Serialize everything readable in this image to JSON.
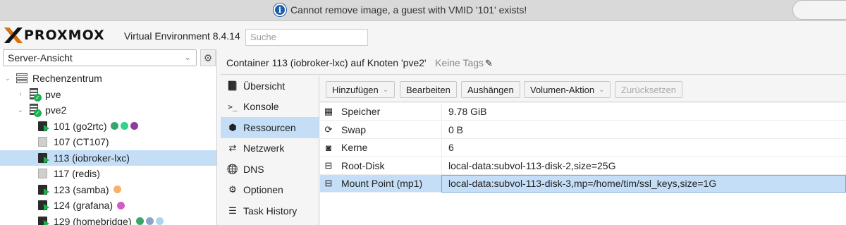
{
  "notification": {
    "message": "Cannot remove image, a guest with VMID '101' exists!",
    "icon": "info-icon"
  },
  "header": {
    "logo_text": "PROXMOX",
    "product": "Virtual Environment 8.4.14",
    "search_placeholder": "Suche"
  },
  "left": {
    "view_select": "Server-Ansicht",
    "tree": [
      {
        "label": "Rechenzentrum",
        "type": "datacenter"
      },
      {
        "label": "pve",
        "type": "node"
      },
      {
        "label": "pve2",
        "type": "node"
      },
      {
        "label": "101 (go2rtc)",
        "type": "ct-running",
        "dots": [
          "#3aa56b",
          "#2fd38e",
          "#8e3c9c"
        ]
      },
      {
        "label": "107 (CT107)",
        "type": "ct-stopped",
        "dots": []
      },
      {
        "label": "113 (iobroker-lxc)",
        "type": "ct-running",
        "dots": [],
        "selected": true
      },
      {
        "label": "117 (redis)",
        "type": "ct-stopped",
        "dots": []
      },
      {
        "label": "123 (samba)",
        "type": "ct-running",
        "dots": [
          "#f6b26b"
        ]
      },
      {
        "label": "124 (grafana)",
        "type": "ct-running",
        "dots": [
          "#d35ac9"
        ]
      },
      {
        "label": "129 (homebridge)",
        "type": "ct-running",
        "dots": [
          "#3aa56b",
          "#8fa3c7",
          "#a9d6ef"
        ]
      }
    ]
  },
  "content": {
    "title": "Container 113 (iobroker-lxc) auf Knoten 'pve2'",
    "tags": "Keine Tags",
    "subnav": [
      {
        "label": "Übersicht",
        "icon": "book-icon"
      },
      {
        "label": "Konsole",
        "icon": "terminal-icon"
      },
      {
        "label": "Ressourcen",
        "icon": "cube-icon",
        "active": true
      },
      {
        "label": "Netzwerk",
        "icon": "exchange-icon"
      },
      {
        "label": "DNS",
        "icon": "globe-icon"
      },
      {
        "label": "Optionen",
        "icon": "gear-icon"
      },
      {
        "label": "Task History",
        "icon": "list-icon"
      }
    ],
    "toolbar": {
      "add": "Hinzufügen",
      "edit": "Bearbeiten",
      "detach": "Aushängen",
      "volume_action": "Volumen-Aktion",
      "revert": "Zurücksetzen"
    },
    "resources": [
      {
        "key": "Speicher",
        "value": "9.78 GiB",
        "icon": "memory-icon"
      },
      {
        "key": "Swap",
        "value": "0 B",
        "icon": "refresh-icon"
      },
      {
        "key": "Kerne",
        "value": "6",
        "icon": "cpu-icon"
      },
      {
        "key": "Root-Disk",
        "value": "local-data:subvol-113-disk-2,size=25G",
        "icon": "hdd-icon"
      },
      {
        "key": "Mount Point (mp1)",
        "value": "local-data:subvol-113-disk-3,mp=/home/tim/ssl_keys,size=1G",
        "icon": "hdd-icon",
        "selected": true
      }
    ]
  }
}
